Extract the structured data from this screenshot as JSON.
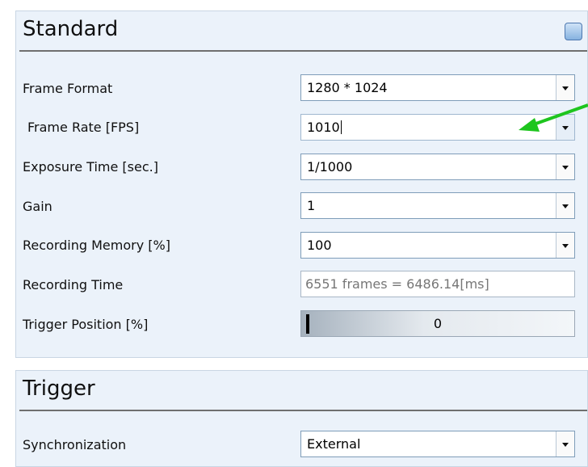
{
  "standard": {
    "title": "Standard",
    "frame_format": {
      "label": "Frame Format",
      "value": "1280 * 1024"
    },
    "frame_rate": {
      "label": "Frame Rate [FPS]",
      "value": "1010"
    },
    "exposure_time": {
      "label": "Exposure Time [sec.]",
      "value": "1/1000"
    },
    "gain": {
      "label": "Gain",
      "value": "1"
    },
    "recording_memory": {
      "label": "Recording Memory [%]",
      "value": "100"
    },
    "recording_time": {
      "label": "Recording Time",
      "value": "6551 frames = 6486.14[ms]"
    },
    "trigger_position": {
      "label": "Trigger Position [%]",
      "value": "0",
      "level_percent": 0
    }
  },
  "trigger": {
    "title": "Trigger",
    "synchronization": {
      "label": "Synchronization",
      "value": "External"
    }
  },
  "colors": {
    "panel_background": "#ebf2fa",
    "annotation_arrow": "#1ec51e"
  },
  "icons": {
    "collapse": "collapse-toggle-icon",
    "dropdown": "chevron-down-icon",
    "annotation": "green-arrow-icon"
  }
}
